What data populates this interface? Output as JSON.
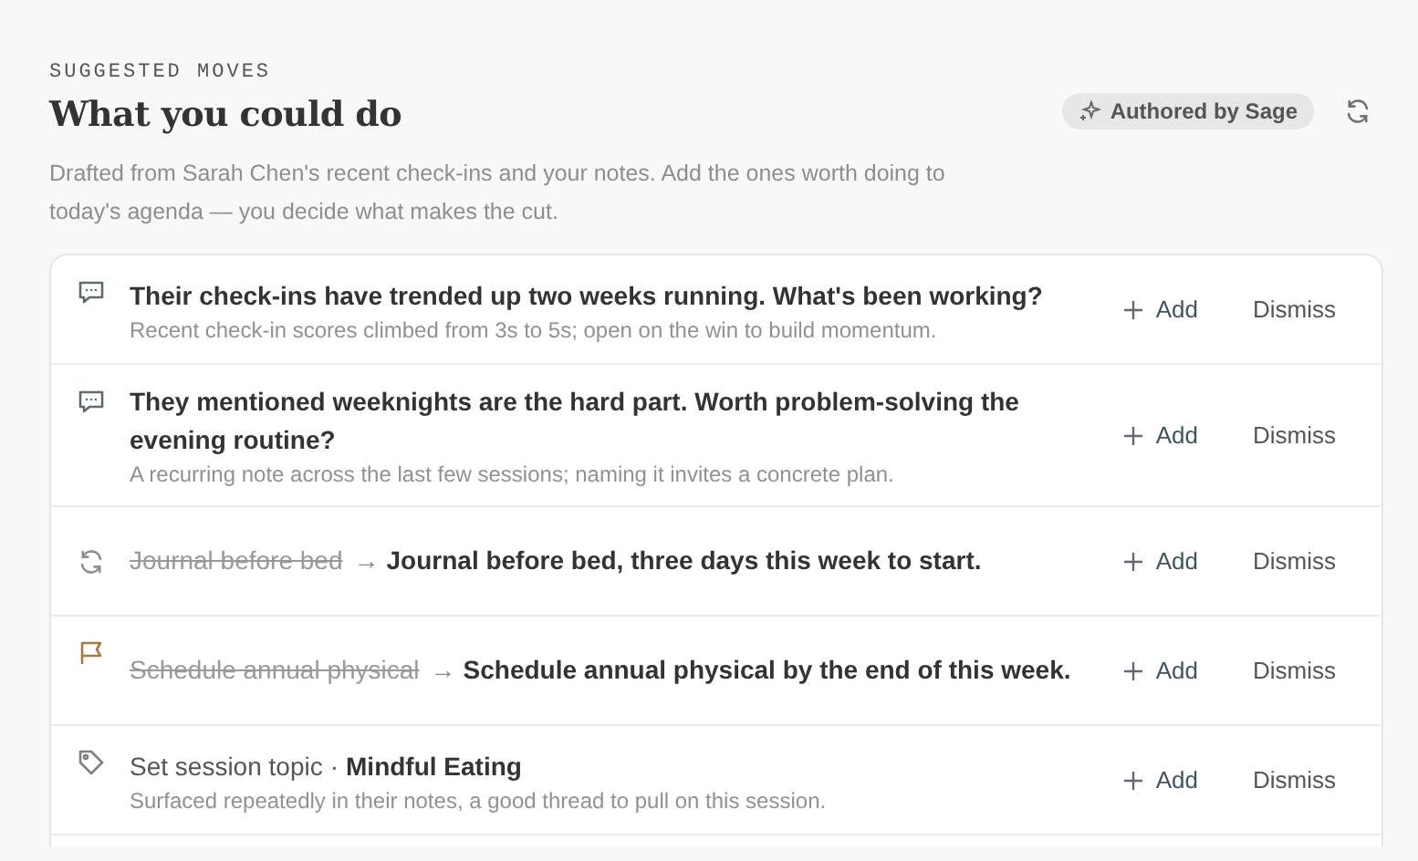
{
  "header": {
    "eyebrow": "SUGGESTED MOVES",
    "title": "What you could do",
    "badge": "Authored by Sage",
    "description": "Drafted from Sarah Chen's recent check-ins and your notes. Add the ones worth doing to today's agenda — you decide what makes the cut."
  },
  "suggestions": [
    {
      "kind": "question",
      "title": "Their check-ins have trended up two weeks running. What's been working?",
      "note": "Recent check-in scores climbed from 3s to 5s; open on the win to build momentum.",
      "add": "Add",
      "dismiss": "Dismiss"
    },
    {
      "kind": "question",
      "title": "They mentioned weeknights are the hard part. Worth problem-solving the evening routine?",
      "note": "A recurring note across the last few sessions; naming it invites a concrete plan.",
      "add": "Add",
      "dismiss": "Dismiss"
    },
    {
      "kind": "habit_edit",
      "old": "Journal before bed",
      "arrow": "→",
      "title": "Journal before bed, three days this week to start.",
      "add": "Add",
      "dismiss": "Dismiss"
    },
    {
      "kind": "goal_edit",
      "old": "Schedule annual physical",
      "arrow": "→",
      "title": "Schedule annual physical by the end of this week.",
      "add": "Add",
      "dismiss": "Dismiss"
    },
    {
      "kind": "topic",
      "label": "Set session topic",
      "separator": "·",
      "title": "Mindful Eating",
      "note": "Surfaced repeatedly in their notes, a good thread to pull on this session.",
      "add": "Add",
      "dismiss": "Dismiss"
    }
  ]
}
